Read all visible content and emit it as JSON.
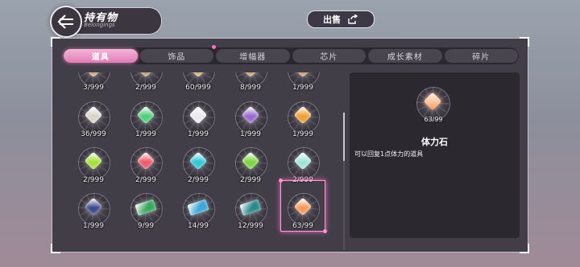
{
  "header": {
    "title": "持有物",
    "subtitle": "Belongings",
    "back_icon": "left-arrow-icon",
    "sell_label": "出售",
    "sell_icon": "export-icon"
  },
  "tabs": [
    {
      "label": "道具",
      "active": true
    },
    {
      "label": "饰品",
      "badge": true
    },
    {
      "label": "增幅器"
    },
    {
      "label": "芯片"
    },
    {
      "label": "成长素材"
    },
    {
      "label": "碎片"
    }
  ],
  "items": [
    {
      "count": "3/999",
      "color": "#c9a77a"
    },
    {
      "count": "2/999",
      "color": "#b9a06a"
    },
    {
      "count": "60/999",
      "color": "#d0b07a"
    },
    {
      "count": "8/999",
      "color": "#c8a072"
    },
    {
      "count": "1/999",
      "color": "#c2a06d"
    },
    {
      "count": "36/999",
      "color": "#d9d4c9"
    },
    {
      "count": "1/999",
      "color": "#4bd07a"
    },
    {
      "count": "1/999",
      "color": "#e8e8ee"
    },
    {
      "count": "1/999",
      "color": "#9a6ad0"
    },
    {
      "count": "1/999",
      "color": "#f0a033"
    },
    {
      "count": "2/999",
      "color": "#a6e03a"
    },
    {
      "count": "2/999",
      "color": "#f05a6a"
    },
    {
      "count": "2/999",
      "color": "#2fc8d8"
    },
    {
      "count": "2/999",
      "color": "#7ad63a"
    },
    {
      "count": "2/999",
      "color": "#9fe4d8"
    },
    {
      "count": "1/999",
      "color": "#3a4a8a"
    },
    {
      "count": "9/99",
      "color": "#3aa860",
      "card": true
    },
    {
      "count": "14/99",
      "color": "#3aa8d8",
      "card": true
    },
    {
      "count": "12/999",
      "color": "#2a8a8a",
      "card": true
    },
    {
      "count": "63/99",
      "color": "#f59a5a",
      "selected": true
    }
  ],
  "detail": {
    "count": "63/99",
    "name": "体力石",
    "description": "可以回复1点体力的道具"
  }
}
